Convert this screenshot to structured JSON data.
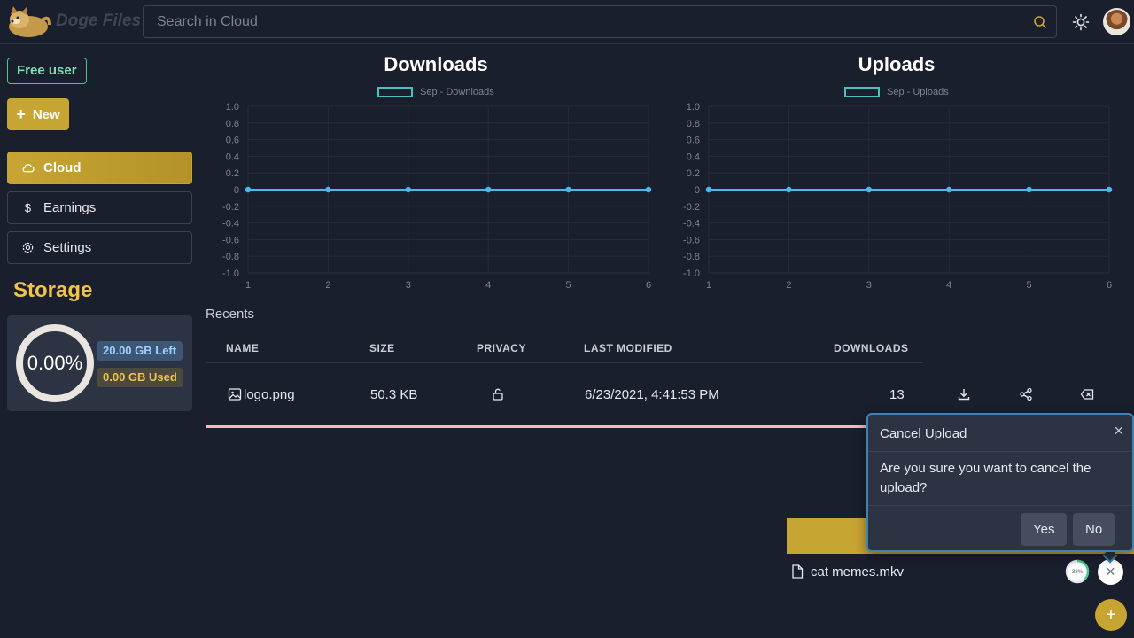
{
  "header": {
    "brand": "Doge Files",
    "search_placeholder": "Search in Cloud"
  },
  "sidebar": {
    "plan_badge": "Free user",
    "new_button": "New",
    "nav": [
      {
        "label": "Cloud",
        "icon": "cloud-icon",
        "active": true
      },
      {
        "label": "Earnings",
        "icon": "dollar-icon",
        "active": false
      },
      {
        "label": "Settings",
        "icon": "gear-icon",
        "active": false
      }
    ],
    "storage": {
      "title": "Storage",
      "percent": "0.00%",
      "left": "20.00 GB Left",
      "used": "0.00 GB Used"
    }
  },
  "chart_data": [
    {
      "type": "line",
      "title": "Downloads",
      "series": [
        {
          "name": "Sep - Downloads",
          "values": [
            0,
            0,
            0,
            0,
            0,
            0
          ]
        }
      ],
      "x": [
        1,
        2,
        3,
        4,
        5,
        6
      ],
      "ylim": [
        -1.0,
        1.0
      ],
      "yticks": [
        "1.0",
        "0.8",
        "0.6",
        "0.4",
        "0.2",
        "0",
        "-0.2",
        "-0.4",
        "-0.6",
        "-0.8",
        "-1.0"
      ],
      "grid": true,
      "legend": "top"
    },
    {
      "type": "line",
      "title": "Uploads",
      "series": [
        {
          "name": "Sep - Uploads",
          "values": [
            0,
            0,
            0,
            0,
            0,
            0
          ]
        }
      ],
      "x": [
        1,
        2,
        3,
        4,
        5,
        6
      ],
      "ylim": [
        -1.0,
        1.0
      ],
      "yticks": [
        "1.0",
        "0.8",
        "0.6",
        "0.4",
        "0.2",
        "0",
        "-0.2",
        "-0.4",
        "-0.6",
        "-0.8",
        "-1.0"
      ],
      "grid": true,
      "legend": "top"
    }
  ],
  "recents": {
    "label": "Recents",
    "columns": [
      "NAME",
      "SIZE",
      "PRIVACY",
      "LAST MODIFIED",
      "DOWNLOADS"
    ],
    "rows": [
      {
        "name": "logo.png",
        "size": "50.3 KB",
        "modified": "6/23/2021, 4:41:53 PM",
        "downloads": "13"
      }
    ]
  },
  "upload": {
    "file": "cat memes.mkv",
    "progress": "38%",
    "progress_value": 0.38
  },
  "modal": {
    "title": "Cancel Upload",
    "body": "Are you sure you want to cancel the upload?",
    "yes": "Yes",
    "no": "No"
  },
  "colors": {
    "accent": "#c7a533",
    "background": "#1a1f2e",
    "series_line": "#4ab8e8",
    "legend_border": "#4bc0c0"
  }
}
